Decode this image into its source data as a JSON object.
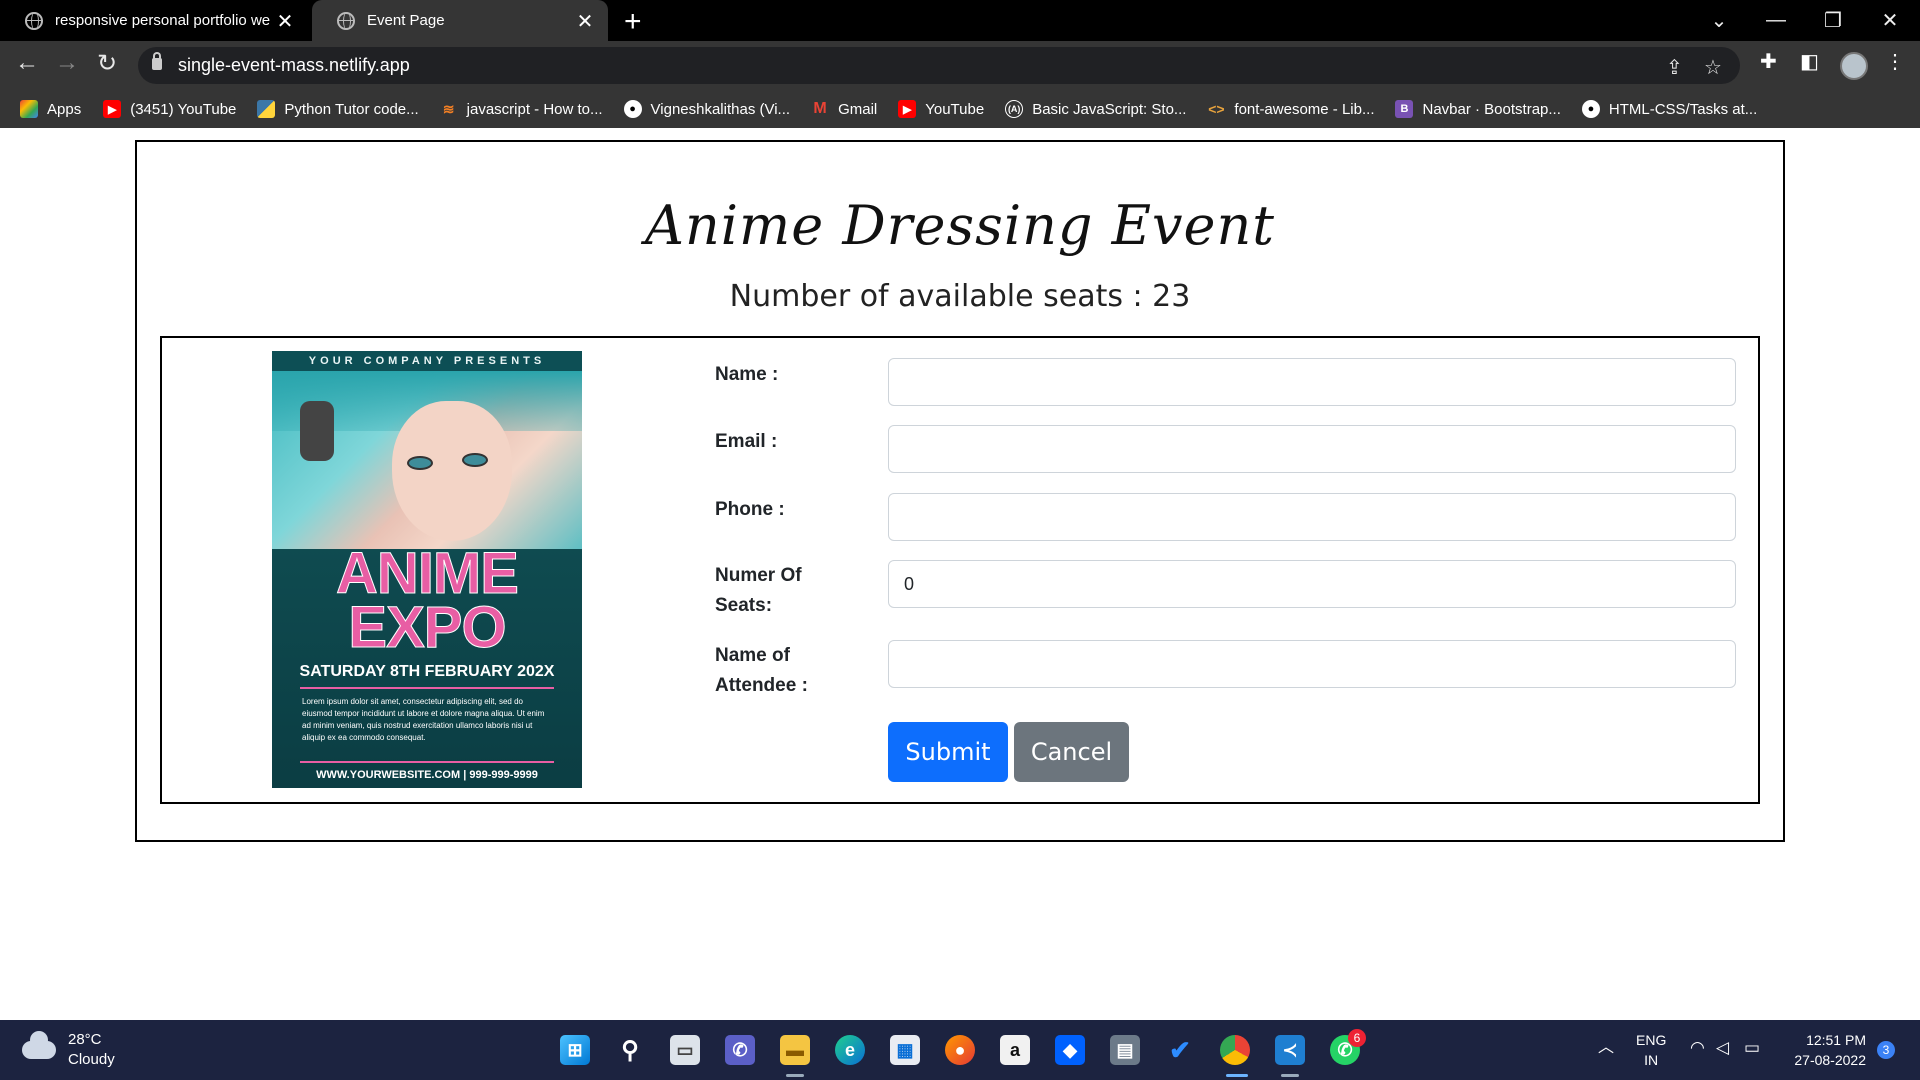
{
  "browser": {
    "tabs": [
      {
        "label": "responsive personal portfolio website"
      },
      {
        "label": "Event Page"
      }
    ],
    "url": "single-event-mass.netlify.app",
    "bookmarks": [
      {
        "label": "Apps",
        "icon": "apps-grid-icon",
        "color": "#ea4335"
      },
      {
        "label": "(3451) YouTube",
        "icon": "youtube-icon",
        "color": "#ff0000"
      },
      {
        "label": "Python Tutor code...",
        "icon": "python-icon",
        "color": "#3b77a8"
      },
      {
        "label": "javascript - How to...",
        "icon": "stackoverflow-icon",
        "color": "#f48024"
      },
      {
        "label": "Vigneshkalithas (Vi...",
        "icon": "github-icon",
        "color": "#ffffff"
      },
      {
        "label": "Gmail",
        "icon": "gmail-icon",
        "color": "#ea4335"
      },
      {
        "label": "YouTube",
        "icon": "youtube-icon",
        "color": "#ff0000"
      },
      {
        "label": "Basic JavaScript: Sto...",
        "icon": "freecodecamp-icon",
        "color": "#0a0a23"
      },
      {
        "label": "font-awesome - Lib...",
        "icon": "code-icon",
        "color": "#e8a33d"
      },
      {
        "label": "Navbar · Bootstrap...",
        "icon": "bootstrap-icon",
        "color": "#7952b3"
      },
      {
        "label": "HTML-CSS/Tasks at...",
        "icon": "github-icon",
        "color": "#ffffff"
      }
    ]
  },
  "page": {
    "title": "Anime Dressing Event",
    "seats_text": "Number of available seats : 23",
    "poster": {
      "top_text": "YOUR COMPANY PRESENTS",
      "headline_1": "ANIME",
      "headline_2": "EXPO",
      "date": "SATURDAY 8TH FEBRUARY 202X",
      "body": "Lorem ipsum dolor sit amet, consectetur adipiscing elit, sed do eiusmod tempor incididunt ut labore et dolore magna aliqua. Ut enim ad minim veniam, quis nostrud exercitation ullamco laboris nisi ut aliquip ex ea commodo consequat.",
      "footer": "WWW.YOURWEBSITE.COM | 999-999-9999"
    },
    "form": {
      "name_label": "Name :",
      "email_label": "Email :",
      "phone_label": "Phone :",
      "seats_label_1": "Numer Of",
      "seats_label_2": "Seats:",
      "seats_value": "0",
      "attendee_label_1": "Name of",
      "attendee_label_2": "Attendee :",
      "submit_label": "Submit",
      "cancel_label": "Cancel"
    }
  },
  "taskbar": {
    "temperature": "28°C",
    "weather": "Cloudy",
    "lang_1": "ENG",
    "lang_2": "IN",
    "time": "12:51 PM",
    "date": "27-08-2022",
    "notification_count": "3",
    "whatsapp_badge": "6"
  },
  "colors": {
    "primary": "#0d6efd",
    "secondary": "#6c757d",
    "poster_pink": "#e85ea4",
    "poster_teal": "#1d6c72"
  }
}
